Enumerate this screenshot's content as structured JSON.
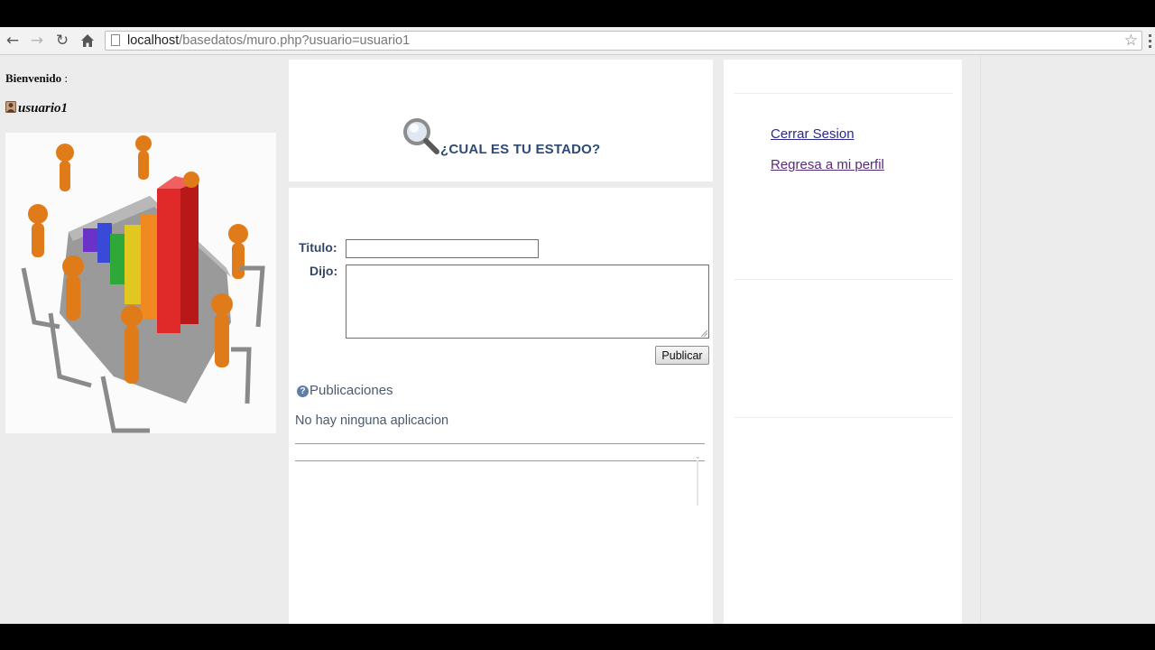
{
  "browser": {
    "url_host": "localhost",
    "url_path": "/basedatos/muro.php?usuario=usuario1",
    "icons": [
      "back-icon",
      "forward-icon",
      "reload-icon",
      "home-icon",
      "page-icon",
      "bookmark-star-icon",
      "menu-icon"
    ]
  },
  "sidebar": {
    "welcome_label": "Bienvenido",
    "welcome_colon": " :",
    "username": "usuario1"
  },
  "status": {
    "title": "¿CUAL ES TU ESTADO?"
  },
  "form": {
    "titulo_label": "Titulo:",
    "titulo_value": "",
    "dijo_label": "Dijo:",
    "dijo_value": "",
    "submit_label": "Publicar"
  },
  "publications": {
    "heading": "Publicaciones",
    "empty_message": "No hay ninguna aplicacion"
  },
  "right_panel": {
    "logout_link": "Cerrar Sesion",
    "profile_link": "Regresa a mi perfil"
  },
  "colors": {
    "heading_blue": "#2c4a73",
    "page_bg": "#ececec",
    "link": "#2a2a8c",
    "visited_link": "#5a2a7a"
  }
}
